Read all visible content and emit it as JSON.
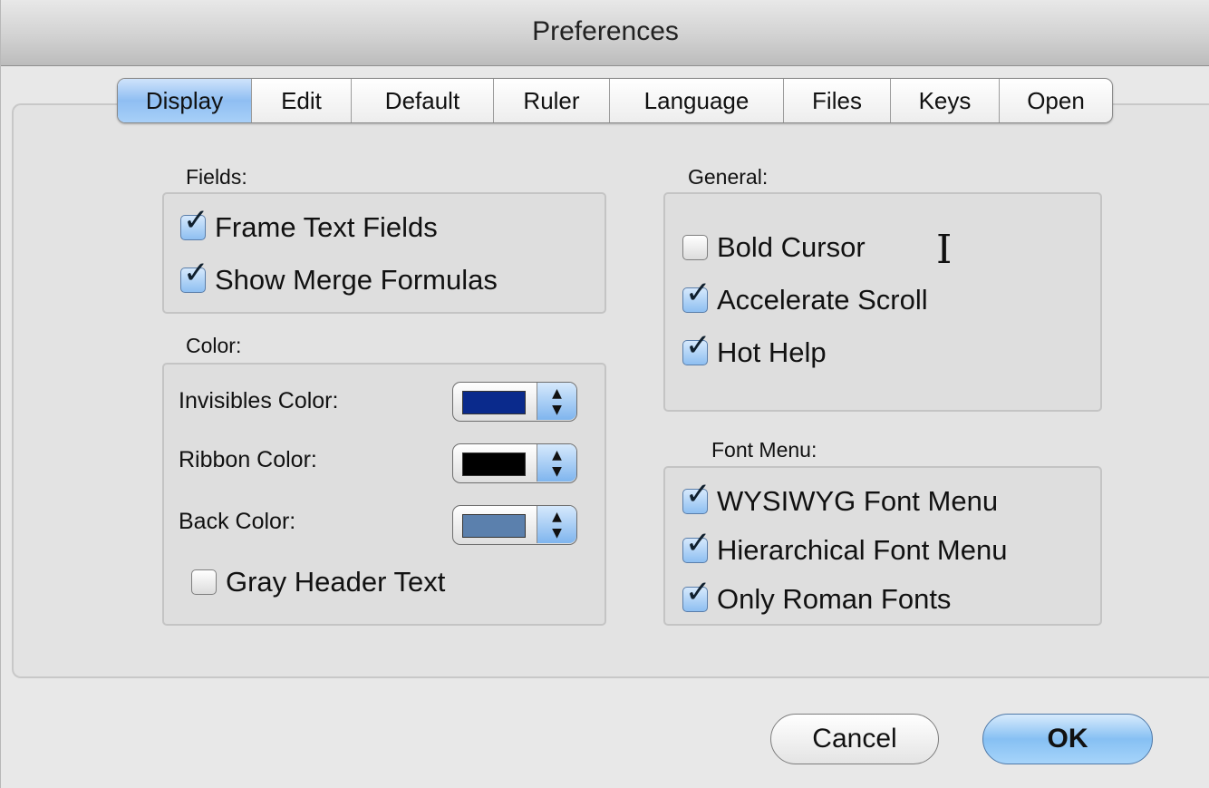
{
  "window": {
    "title": "Preferences"
  },
  "tabs": [
    {
      "label": "Display",
      "active": true
    },
    {
      "label": "Edit",
      "active": false
    },
    {
      "label": "Default",
      "active": false
    },
    {
      "label": "Ruler",
      "active": false
    },
    {
      "label": "Language",
      "active": false
    },
    {
      "label": "Files",
      "active": false
    },
    {
      "label": "Keys",
      "active": false
    },
    {
      "label": "Open",
      "active": false
    }
  ],
  "fields": {
    "label": "Fields:",
    "items": [
      {
        "label": "Frame Text Fields",
        "checked": true
      },
      {
        "label": "Show Merge Formulas",
        "checked": true
      }
    ]
  },
  "color": {
    "label": "Color:",
    "rows": [
      {
        "label": "Invisibles Color:",
        "value": "#0a2a8c"
      },
      {
        "label": "Ribbon Color:",
        "value": "#000000"
      },
      {
        "label": "Back Color:",
        "value": "#5b80ad"
      }
    ],
    "gray_header": {
      "label": "Gray Header Text",
      "checked": false
    }
  },
  "general": {
    "label": "General:",
    "items": [
      {
        "label": "Bold Cursor",
        "checked": false
      },
      {
        "label": "Accelerate Scroll",
        "checked": true
      },
      {
        "label": "Hot Help",
        "checked": true
      }
    ]
  },
  "font_menu": {
    "label": "Font Menu:",
    "items": [
      {
        "label": "WYSIWYG Font Menu",
        "checked": true
      },
      {
        "label": "Hierarchical Font Menu",
        "checked": true
      },
      {
        "label": "Only Roman Fonts",
        "checked": true
      }
    ]
  },
  "buttons": {
    "cancel": "Cancel",
    "ok": "OK"
  },
  "icons": {
    "check": "checkmark-icon",
    "stepper": "up-down-arrows-icon",
    "cursor": "text-cursor-icon"
  }
}
